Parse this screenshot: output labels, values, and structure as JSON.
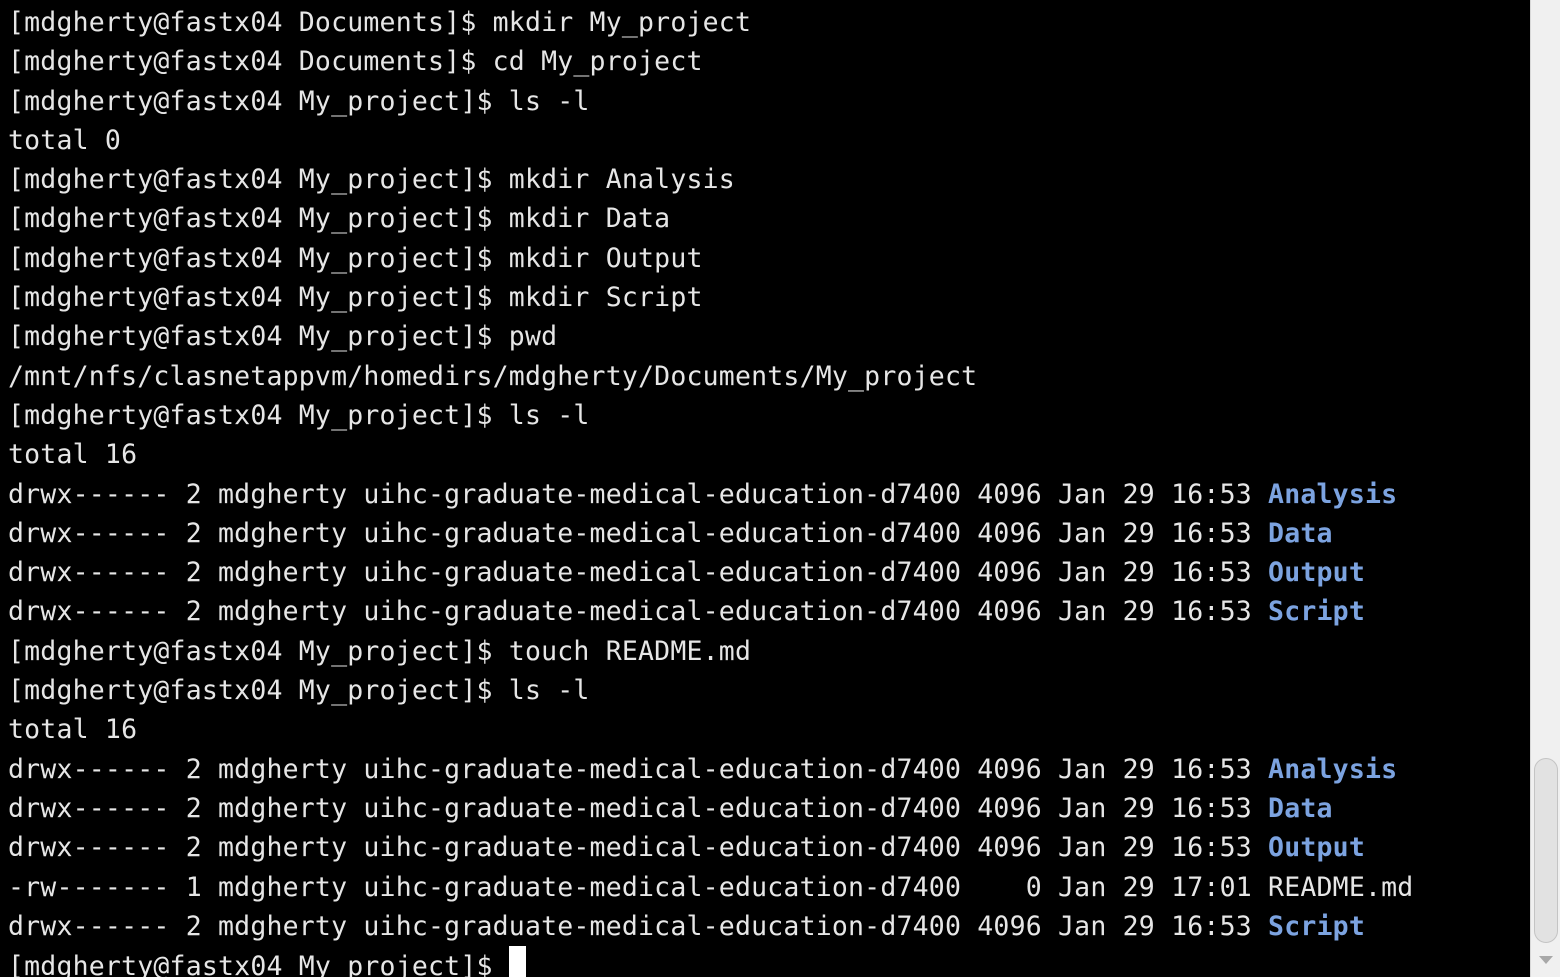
{
  "terminal": {
    "lines": [
      {
        "text": "[mdgherty@fastx04 Documents]$ mkdir My_project"
      },
      {
        "text": "[mdgherty@fastx04 Documents]$ cd My_project"
      },
      {
        "text": "[mdgherty@fastx04 My_project]$ ls -l"
      },
      {
        "text": "total 0"
      },
      {
        "text": "[mdgherty@fastx04 My_project]$ mkdir Analysis"
      },
      {
        "text": "[mdgherty@fastx04 My_project]$ mkdir Data"
      },
      {
        "text": "[mdgherty@fastx04 My_project]$ mkdir Output"
      },
      {
        "text": "[mdgherty@fastx04 My_project]$ mkdir Script"
      },
      {
        "text": "[mdgherty@fastx04 My_project]$ pwd"
      },
      {
        "text": "/mnt/nfs/clasnetappvm/homedirs/mdgherty/Documents/My_project"
      },
      {
        "text": "[mdgherty@fastx04 My_project]$ ls -l"
      },
      {
        "text": "total 16"
      },
      {
        "text": "drwx------ 2 mdgherty uihc-graduate-medical-education-d7400 4096 Jan 29 16:53 ",
        "name": "Analysis",
        "dir": true
      },
      {
        "text": "drwx------ 2 mdgherty uihc-graduate-medical-education-d7400 4096 Jan 29 16:53 ",
        "name": "Data",
        "dir": true
      },
      {
        "text": "drwx------ 2 mdgherty uihc-graduate-medical-education-d7400 4096 Jan 29 16:53 ",
        "name": "Output",
        "dir": true
      },
      {
        "text": "drwx------ 2 mdgherty uihc-graduate-medical-education-d7400 4096 Jan 29 16:53 ",
        "name": "Script",
        "dir": true
      },
      {
        "text": "[mdgherty@fastx04 My_project]$ touch README.md"
      },
      {
        "text": "[mdgherty@fastx04 My_project]$ ls -l"
      },
      {
        "text": "total 16"
      },
      {
        "text": "drwx------ 2 mdgherty uihc-graduate-medical-education-d7400 4096 Jan 29 16:53 ",
        "name": "Analysis",
        "dir": true
      },
      {
        "text": "drwx------ 2 mdgherty uihc-graduate-medical-education-d7400 4096 Jan 29 16:53 ",
        "name": "Data",
        "dir": true
      },
      {
        "text": "drwx------ 2 mdgherty uihc-graduate-medical-education-d7400 4096 Jan 29 16:53 ",
        "name": "Output",
        "dir": true
      },
      {
        "text": "-rw------- 1 mdgherty uihc-graduate-medical-education-d7400    0 Jan 29 17:01 ",
        "name": "README.md",
        "dir": false
      },
      {
        "text": "drwx------ 2 mdgherty uihc-graduate-medical-education-d7400 4096 Jan 29 16:53 ",
        "name": "Script",
        "dir": true
      }
    ],
    "prompt": "[mdgherty@fastx04 My_project]$ ",
    "colors": {
      "background": "#000000",
      "foreground": "#e6e6e6",
      "directory": "#7ca3e0",
      "cursor": "#ffffff"
    }
  }
}
